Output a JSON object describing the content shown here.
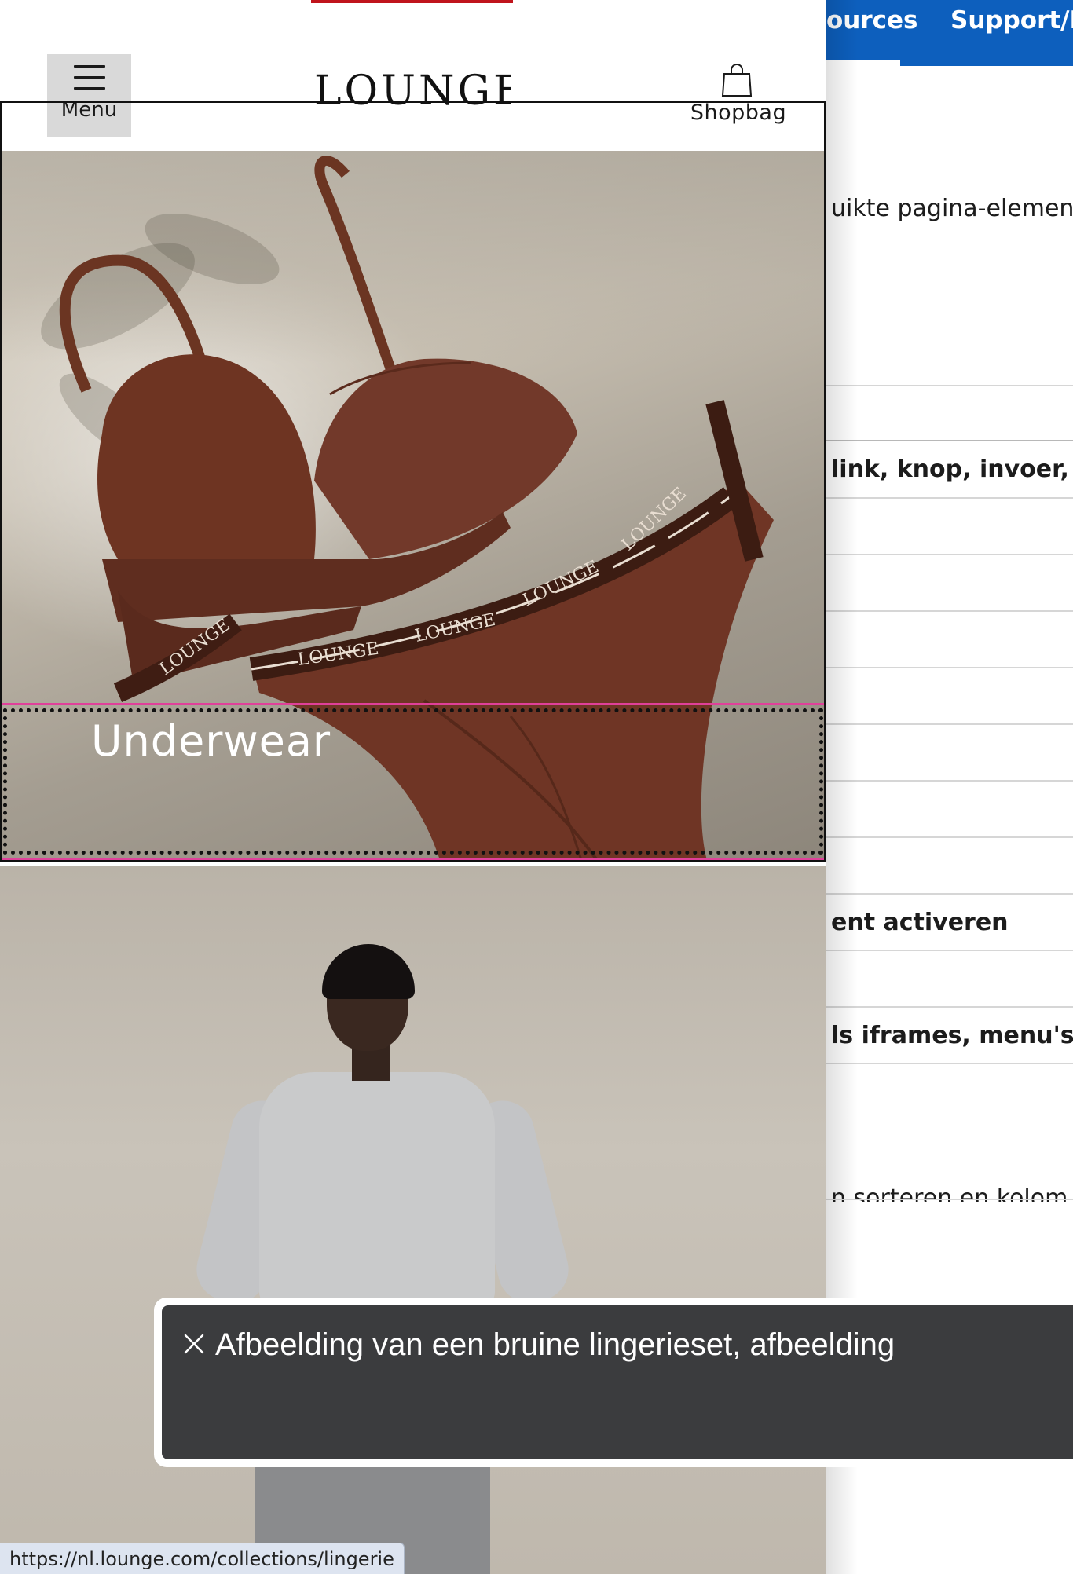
{
  "background_page": {
    "tabs": {
      "resources": "ources",
      "support": "Support/H"
    },
    "rows": [
      {
        "text": "uikte pagina-element",
        "bold": false
      },
      {
        "text": "",
        "bold": false
      },
      {
        "text": "link, knop, invoer, er",
        "bold": true
      },
      {
        "text": "",
        "bold": false
      },
      {
        "text": "",
        "bold": false
      },
      {
        "text": "",
        "bold": false
      },
      {
        "text": "",
        "bold": false
      },
      {
        "text": "",
        "bold": false
      },
      {
        "text": "ent activeren",
        "bold": true
      },
      {
        "text": "",
        "bold": false
      },
      {
        "text": "ls iframes, menu's, t",
        "bold": true
      },
      {
        "text": "n sorteren en kolom",
        "bold": false
      }
    ]
  },
  "header": {
    "menu_label": "Menu",
    "logo": "LOUNGE",
    "shopbag_label": "Shopbag"
  },
  "hero": {
    "category_label": "Underwear",
    "band_text": "LOUNGE"
  },
  "caption": {
    "text": "Afbeelding van een bruine lingerieset, afbeelding"
  },
  "status_bar": {
    "url": "https://nl.lounge.com/collections/lingerie"
  },
  "icons": {
    "menu": "hamburger-icon",
    "bag": "shopping-bag-icon",
    "close": "close-icon"
  },
  "colors": {
    "accent_blue": "#0d5fbd",
    "focus_pink": "#e0409a",
    "red_bar": "#c0141c",
    "caption_bg": "#3b3c3e"
  }
}
